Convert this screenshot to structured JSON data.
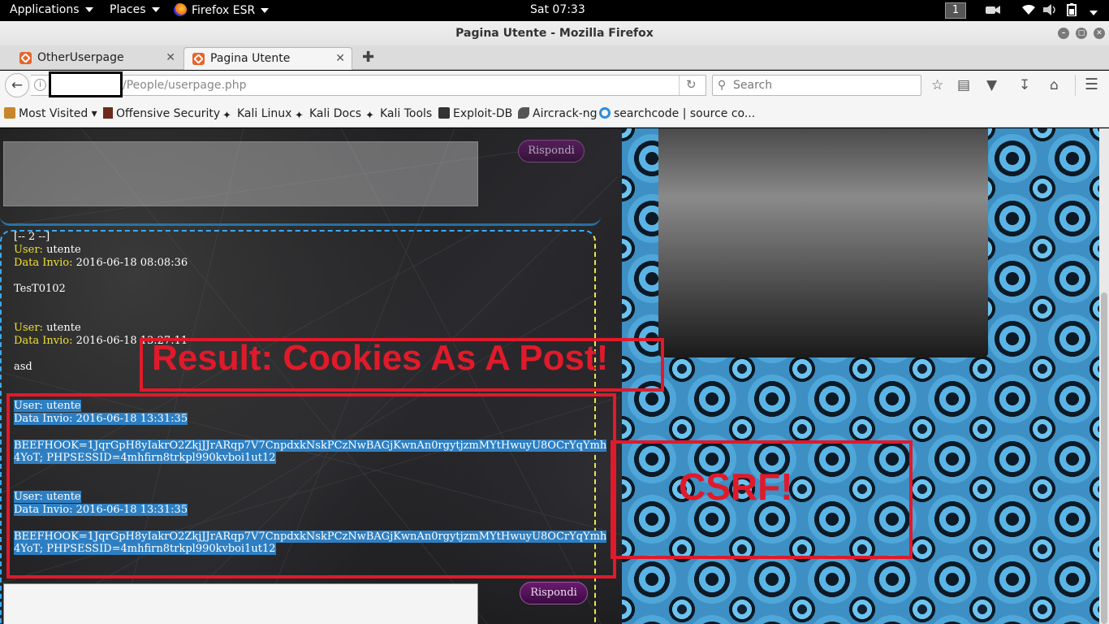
{
  "topbar": {
    "applications": "Applications",
    "places": "Places",
    "firefox": "Firefox ESR",
    "clock": "Sat 07:33",
    "workspace": "1"
  },
  "window": {
    "title": "Pagina Utente - Mozilla Firefox"
  },
  "tabs": [
    {
      "label": "OtherUserpage"
    },
    {
      "label": "Pagina Utente"
    }
  ],
  "nav": {
    "url_path": "/People/userpage.php",
    "search_placeholder": "Search"
  },
  "bookmarks": [
    {
      "label": "Most Visited ▾"
    },
    {
      "label": "Offensive Security"
    },
    {
      "label": "Kali Linux"
    },
    {
      "label": "Kali Docs"
    },
    {
      "label": "Kali Tools"
    },
    {
      "label": "Exploit-DB"
    },
    {
      "label": "Aircrack-ng"
    },
    {
      "label": "searchcode | source co..."
    }
  ],
  "page": {
    "reply_label": "Rispondi",
    "post_header": "[-- 2 --]",
    "user_label": "User:",
    "date_label": "Data Invio:",
    "posts": [
      {
        "user": "utente",
        "date": "2016-06-18 08:08:36",
        "body": "TesT0102"
      },
      {
        "user": "utente",
        "date": "2016-06-18 13:27:11",
        "body": "asd"
      }
    ],
    "cookie_posts": [
      {
        "user_line": "User: utente",
        "date_line": "Data Invio: 2016-06-18 13:31:35",
        "body_1": "BEEFHOOK=1JqrGpH8yIakrO2ZkjJJrARqp7V7CnpdxkNskPCzNwBAGjKwnAn0rgytjzmMYtHwuyU8OCrYqYmh",
        "body_2": "4YoT; PHPSESSID=4mhfirn8trkpl990kvboi1ut12"
      },
      {
        "user_line": "User: utente",
        "date_line": "Data Invio: 2016-06-18 13:31:35",
        "body_1": "BEEFHOOK=1JqrGpH8yIakrO2ZkjJJrARqp7V7CnpdxkNskPCzNwBAGjKwnAn0rgytjzmMYtHwuyU8OCrYqYmh",
        "body_2": "4YoT; PHPSESSID=4mhfirn8trkpl990kvboi1ut12"
      }
    ]
  },
  "annotations": {
    "result": "Result: Cookies As A Post!",
    "csrf": "CSRF!",
    "color": "#e01a2a"
  }
}
